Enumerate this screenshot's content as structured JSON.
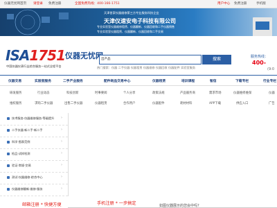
{
  "topbar": {
    "site_name": "仪器无忧网首页",
    "login": "请登录",
    "register": "免费注册",
    "hotline": "全国免费热线：400-166-1751",
    "user_center": "用户中心",
    "free_register": "免费注册",
    "mobile": "手机版"
  },
  "banner": {
    "line1": "天津首家仪器维修第三方专业服务科技企业",
    "company": "天津仪速安电子科技有限公司",
    "line3": "专业实验室仪器维修租赁、仪器翻新、仪器回收和二手仪器销售",
    "line4": "专业实验室仪器租赁、仪器翻新、仪器回收和二手交易"
  },
  "logo": {
    "brand": "ISA",
    "brand_num": "1751",
    "cn": "仪器无忧网"
  },
  "slogan": "中国仪器仪表行业综合服务一站式全程平台",
  "search": {
    "category": "出产品",
    "button": "搜索",
    "hot_label": "热门搜索：",
    "hot_items": "仪器  二手仪器  仪器租赁  仪器维修  仪器回收  仪器配件  实验室服务"
  },
  "hotline_block": {
    "label": "服务热线：",
    "number": "400-",
    "sub": "(9:0"
  },
  "nav": [
    {
      "label": "仪器交易"
    },
    {
      "label": "实验室服务"
    },
    {
      "label": "二手产业服务"
    },
    {
      "label": "配件耗品交易中心"
    },
    {
      "label": "仪器租赁"
    },
    {
      "label": "培训课程"
    },
    {
      "label": "智信"
    },
    {
      "label": "下载专栏"
    },
    {
      "label": "行业专栏"
    }
  ],
  "subrow1": [
    "研发服务",
    "行业动态",
    "科技创新",
    "时事要闻",
    "个人分享",
    "政策法规",
    "产品服务商",
    "需求市场",
    "仪器维修维保",
    "仪器"
  ],
  "subrow2": [
    "维权服务",
    "求购二手仪器",
    "出售二手仪器",
    "仪器租赁",
    "合作用户",
    "仪器配件",
    "耗材材料",
    "APP下载",
    "供应入口",
    "广告"
  ],
  "side_menu": [
    "技术服务·仪器维修服务·等级提升",
    "二手仪器·新二手·新二手",
    "科学·图表范例",
    "检品·试样检测",
    "验证·常规·交易",
    "测试·仪器维修·综合中心",
    "仪器维修翻新·维修·服务"
  ],
  "bottom": {
    "left": "邮箱注册 * 快捷方便",
    "mid": "手机注册 * 一步搞定",
    "right": "如图仪器展示的您会中吗?"
  },
  "colors": {
    "brand": "#1e4f96",
    "accent": "#e02020",
    "nav_text": "#1e3f7a"
  }
}
